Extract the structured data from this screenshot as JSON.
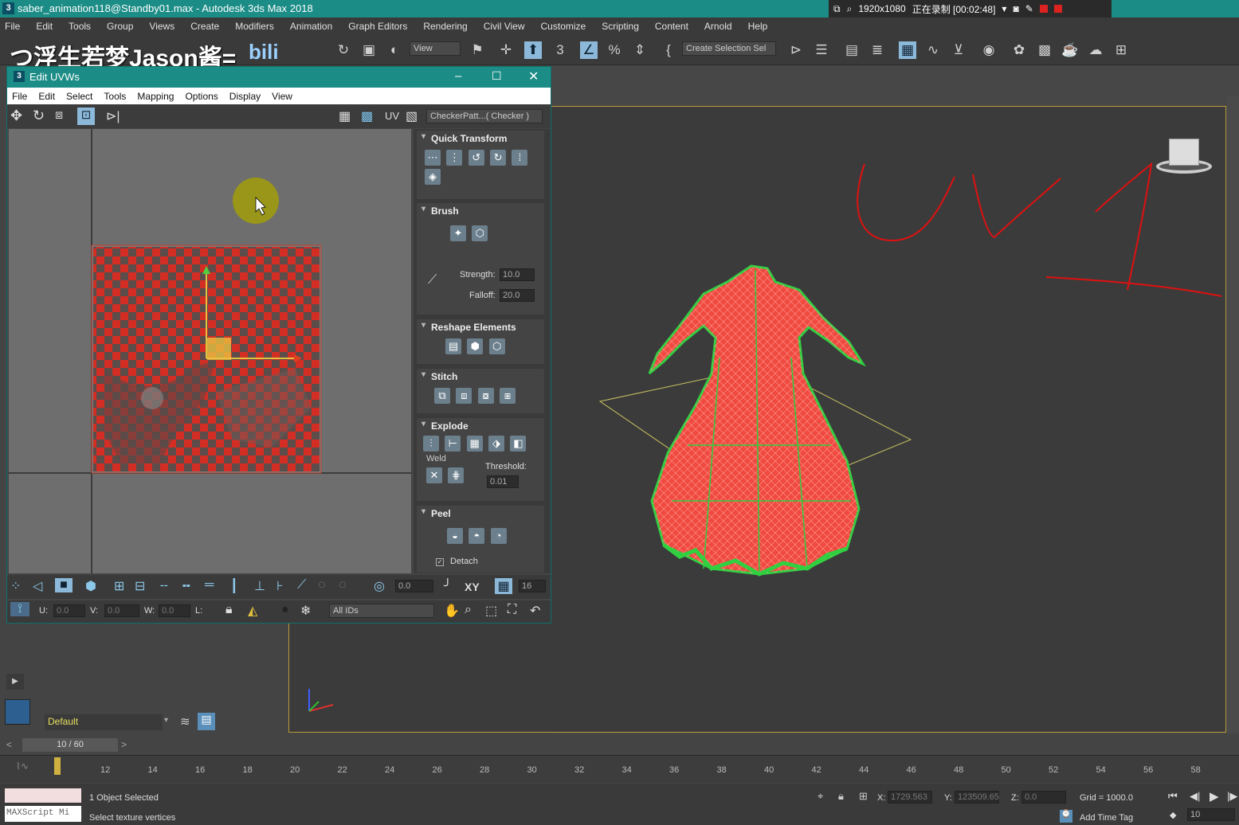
{
  "titlebar": {
    "title": "saber_animation118@Standby01.max - Autodesk 3ds Max 2018",
    "app_icon": "3"
  },
  "recorder": {
    "resolution": "1920x1080",
    "status": "正在录制 [00:02:48]"
  },
  "menubar": {
    "items": [
      "File",
      "Edit",
      "Tools",
      "Group",
      "Views",
      "Create",
      "Modifiers",
      "Animation",
      "Graph Editors",
      "Rendering",
      "Civil View",
      "Customize",
      "Scripting",
      "Content",
      "Arnold",
      "Help"
    ]
  },
  "watermark": {
    "text": "つ浮生若梦Jason酱="
  },
  "toolbar": {
    "view_combo": "View",
    "selection_set_combo": "Create Selection Sel",
    "snap_number": "3"
  },
  "uv_editor": {
    "title": "Edit UVWs",
    "icon": "3",
    "menu": [
      "File",
      "Edit",
      "Select",
      "Tools",
      "Mapping",
      "Options",
      "Display",
      "View"
    ],
    "uv_label": "UV",
    "texture_combo": "CheckerPatt...( Checker )",
    "rollouts": {
      "quick_transform": "Quick Transform",
      "brush": "Brush",
      "strength_label": "Strength:",
      "strength_value": "10.0",
      "falloff_label": "Falloff:",
      "falloff_value": "20.0",
      "reshape": "Reshape Elements",
      "stitch": "Stitch",
      "explode": "Explode",
      "weld_label": "Weld",
      "threshold_label": "Threshold:",
      "threshold_value": "0.01",
      "peel": "Peel",
      "detach_label": "Detach"
    },
    "bottom": {
      "spin_value": "0.0",
      "xy_label": "XY",
      "grid_value": "16",
      "u_label": "U:",
      "u_value": "0.0",
      "v_label": "V:",
      "v_value": "0.0",
      "w_label": "W:",
      "w_value": "0.0",
      "l_label": "L:",
      "ids_combo": "All IDs"
    }
  },
  "annotation": {
    "text": "UV1",
    "color": "#e01010"
  },
  "layer": {
    "name": "Default"
  },
  "time": {
    "slider": "10 / 60",
    "ticks": [
      "12",
      "14",
      "16",
      "18",
      "20",
      "22",
      "24",
      "26",
      "28",
      "30",
      "32",
      "34",
      "36",
      "38",
      "40",
      "42",
      "44",
      "46",
      "48",
      "50",
      "52",
      "54",
      "56",
      "58"
    ]
  },
  "status": {
    "maxscript": "MAXScript Mi",
    "selected": "1 Object Selected",
    "prompt": "Select texture vertices",
    "x_label": "X:",
    "x_value": "1729.563",
    "y_label": "Y:",
    "y_value": "123509.65",
    "z_label": "Z:",
    "z_value": "0.0",
    "grid": "Grid = 1000.0",
    "add_time_tag": "Add Time Tag",
    "frame_value": "10"
  },
  "colors": {
    "title_teal": "#1b8c86",
    "uv_red": "#d92a20",
    "selection_yellow": "#e8c040",
    "mesh_green": "#30d040"
  }
}
